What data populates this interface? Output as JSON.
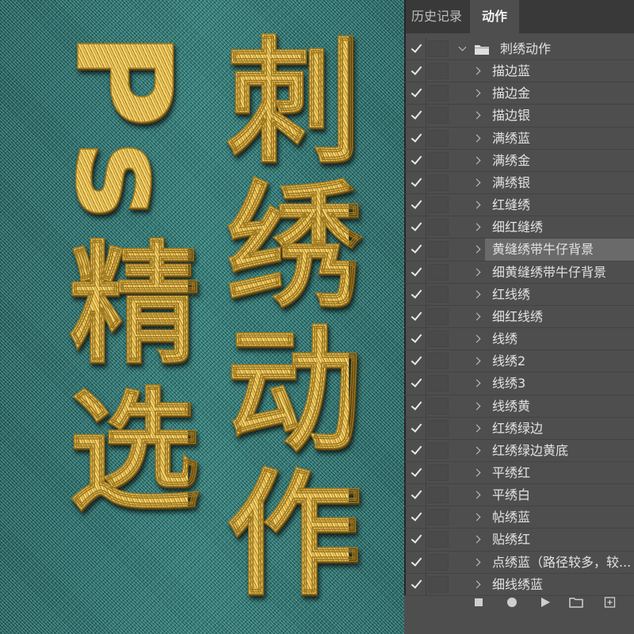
{
  "artwork": {
    "left_title": "Ps精选",
    "right_title": "刺绣动作"
  },
  "panel": {
    "tabs": [
      {
        "label": "历史记录",
        "active": false
      },
      {
        "label": "动作",
        "active": true
      }
    ],
    "action_set": {
      "name": "刺绣动作",
      "enabled": true,
      "expanded": true,
      "icon": "folder-icon"
    },
    "actions": [
      {
        "name": "描边蓝",
        "enabled": true
      },
      {
        "name": "描边金",
        "enabled": true
      },
      {
        "name": "描边银",
        "enabled": true
      },
      {
        "name": "满绣蓝",
        "enabled": true
      },
      {
        "name": "满绣金",
        "enabled": true
      },
      {
        "name": "满绣银",
        "enabled": true
      },
      {
        "name": "红缝绣",
        "enabled": true
      },
      {
        "name": "细红缝绣",
        "enabled": true
      },
      {
        "name": "黄缝绣带牛仔背景",
        "enabled": true,
        "selected": true
      },
      {
        "name": "细黄缝绣带牛仔背景",
        "enabled": true
      },
      {
        "name": "红线绣",
        "enabled": true
      },
      {
        "name": "细红线绣",
        "enabled": true
      },
      {
        "name": "线绣",
        "enabled": true
      },
      {
        "name": "线绣2",
        "enabled": true
      },
      {
        "name": "线绣3",
        "enabled": true
      },
      {
        "name": "线绣黄",
        "enabled": true
      },
      {
        "name": "红绣绿边",
        "enabled": true
      },
      {
        "name": "红绣绿边黄底",
        "enabled": true
      },
      {
        "name": "平绣红",
        "enabled": true
      },
      {
        "name": "平绣白",
        "enabled": true
      },
      {
        "name": "帖绣蓝",
        "enabled": true
      },
      {
        "name": "贴绣红",
        "enabled": true
      },
      {
        "name": "点绣蓝（路径较多，较...",
        "enabled": true
      },
      {
        "name": "细线绣蓝",
        "enabled": true
      }
    ],
    "toolbar_icons": [
      "stop-icon",
      "record-icon",
      "play-icon",
      "new-set-folder-icon",
      "new-action-icon"
    ]
  },
  "colors": {
    "denim": "#2d6e6b",
    "gold": "#e8c45c",
    "panel_bg": "#4e4e4e",
    "tab_bar_bg": "#393939",
    "selected_row_bg": "#6a6a6a",
    "text": "#e2e2e2"
  }
}
